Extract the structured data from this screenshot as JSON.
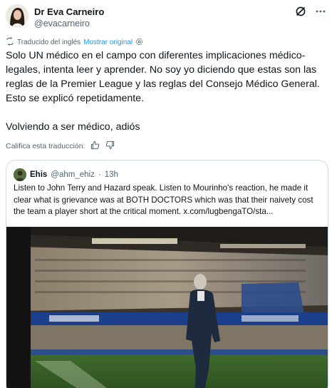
{
  "author": {
    "name": "Dr Eva Carneiro",
    "handle": "@evacarneiro"
  },
  "translation": {
    "label": "Traducido del inglés",
    "show_original": "Mostrar original"
  },
  "tweet": {
    "paragraph1": "Solo UN médico en el campo con diferentes implicaciones médico-legales, intenta leer y aprender. No soy yo diciendo que estas son las reglas de la Premier League y las reglas del Consejo Médico General. Esto se explicó repetidamente.",
    "paragraph2": "Volviendo a ser médico, adiós"
  },
  "rate_translation": {
    "label": "Califica esta traducción:"
  },
  "quoted": {
    "name": "Ehis",
    "handle": "@ahm_ehiz",
    "time": "13h",
    "text": "Listen to John Terry and Hazard speak. Listen to Mourinho's reaction, he made it clear what is grievance was at BOTH DOCTORS which was that their naivety cost the team a player short at the critical moment.  x.com/lugbengaTO/sta..."
  },
  "colors": {
    "link": "#1d9bf0",
    "secondary_text": "#536471",
    "border": "#cfd9de"
  }
}
